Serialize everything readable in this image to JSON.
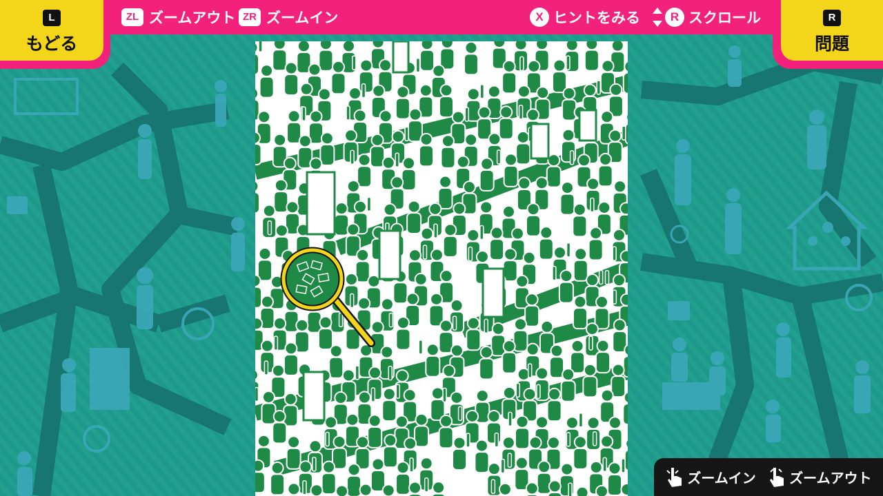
{
  "header": {
    "back": {
      "key": "L",
      "label": "もどる"
    },
    "zoom_out": {
      "key": "ZL",
      "label": "ズームアウト"
    },
    "zoom_in": {
      "key": "ZR",
      "label": "ズームイン"
    },
    "hint": {
      "key": "X",
      "label": "ヒントをみる"
    },
    "scroll": {
      "key": "R",
      "label": "スクロール"
    },
    "question": {
      "key": "R",
      "label": "問題"
    }
  },
  "touch_controls": {
    "zoom_in_label": "ズームイン",
    "zoom_out_label": "ズームアウト"
  },
  "colors": {
    "bar_pink": "#f2217c",
    "button_yellow": "#f3d619",
    "map_teal": "#1f9c8a",
    "crowd_green": "#1f8a45"
  },
  "icons": [
    "magnifier-icon",
    "touch-hand-icon",
    "up-down-arrow-icon"
  ]
}
